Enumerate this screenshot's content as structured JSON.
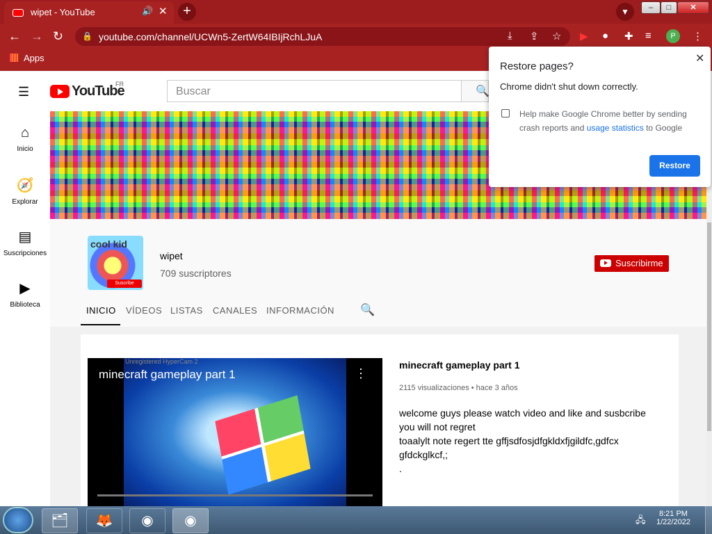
{
  "browser": {
    "tab_title": "wipet - YouTube",
    "url": "youtube.com/channel/UCWn5-ZertW64IBIjRchLJuA",
    "bookmarks_apps": "Apps",
    "profile_letter": "P"
  },
  "youtube": {
    "logo_text": "YouTube",
    "region": "FR",
    "search_placeholder": "Buscar",
    "sidebar": [
      {
        "label": "Inicio",
        "icon": "home-icon"
      },
      {
        "label": "Explorar",
        "icon": "compass-icon"
      },
      {
        "label": "Suscripciones",
        "icon": "subscriptions-icon"
      },
      {
        "label": "Biblioteca",
        "icon": "library-icon"
      }
    ],
    "channel": {
      "name": "wipet",
      "subscribers": "709 suscriptores",
      "subscribe_label": "Suscribirme",
      "avatar_text": "cool kid",
      "avatar_badge": "Suscribe"
    },
    "tabs": [
      "INICIO",
      "VÍDEOS",
      "LISTAS",
      "CANALES",
      "INFORMACIÓN"
    ],
    "featured": {
      "player_title": "minecraft gameplay part 1",
      "watermark": "Unregistered HyperCam 2",
      "title": "minecraft gameplay part 1",
      "views": "2115 visualizaciones",
      "age": "hace 3 años",
      "description": [
        "welcome guys please watch video and like and susbcribe",
        "you will not regret",
        "toaalylt note regert tte gffjsdfosjdfgkldxfjgildfc,gdfcx",
        "gfdckglkcf,;",
        "."
      ]
    }
  },
  "popup": {
    "title": "Restore pages?",
    "message": "Chrome didn't shut down correctly.",
    "checkbox_line1": "Help make Google Chrome better by sending",
    "checkbox_line2_pre": "crash reports and ",
    "checkbox_link": "usage statistics",
    "checkbox_line2_post": " to Google",
    "button": "Restore"
  },
  "taskbar": {
    "time": "8:21 PM",
    "date": "1/22/2022"
  }
}
